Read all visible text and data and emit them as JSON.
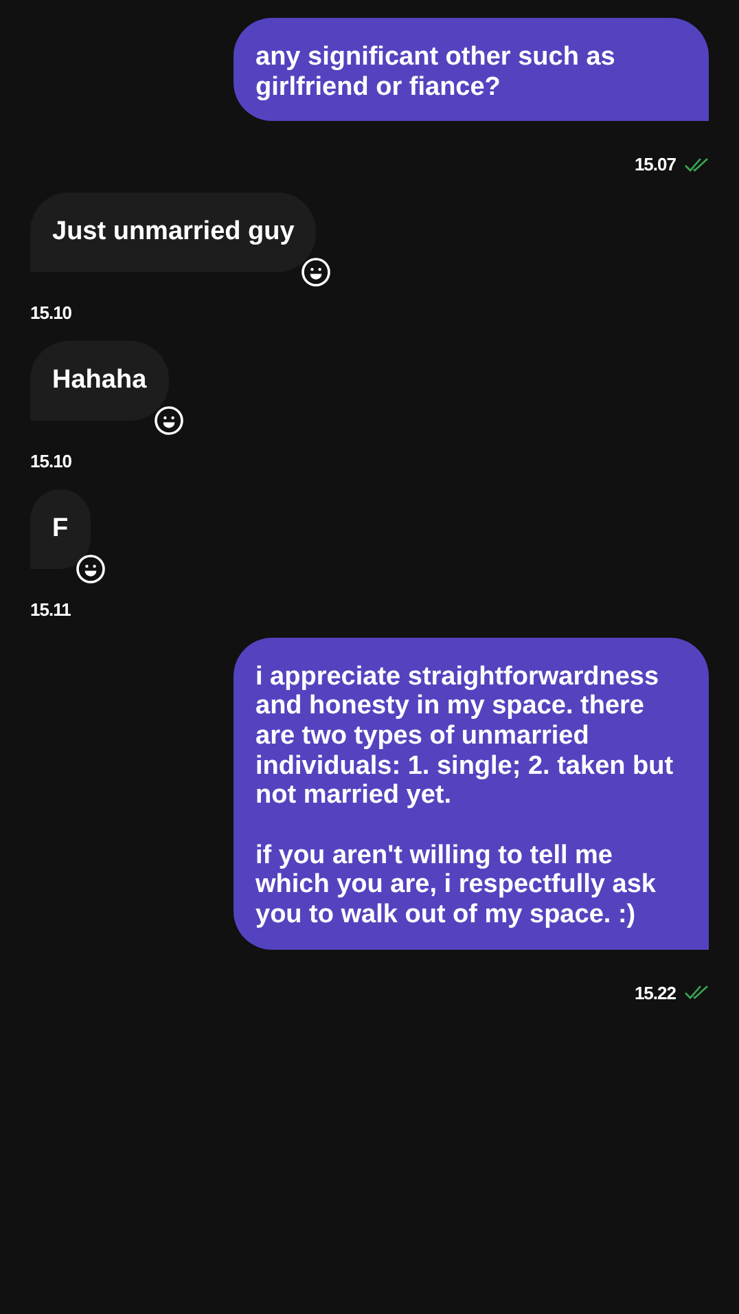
{
  "messages": [
    {
      "kind": "sent",
      "paragraphs": [
        "any significant other such as girlfriend or fiance?"
      ],
      "time": "15.07",
      "read": true
    },
    {
      "kind": "received",
      "paragraphs": [
        "Just unmarried guy"
      ],
      "time": "15.10",
      "reacted": true
    },
    {
      "kind": "received",
      "paragraphs": [
        "Hahaha"
      ],
      "time": "15.10",
      "reacted": true
    },
    {
      "kind": "received",
      "paragraphs": [
        "F"
      ],
      "time": "15.11",
      "reacted": true
    },
    {
      "kind": "sent",
      "paragraphs": [
        "i appreciate straightforwardness and honesty in my space. there are two types of unmarried individuals: 1. single; 2. taken but not married yet.",
        "if you aren't willing to tell me which you are, i respectfully ask you to walk out of my space. :)"
      ],
      "time": "15.22",
      "read": true
    }
  ]
}
